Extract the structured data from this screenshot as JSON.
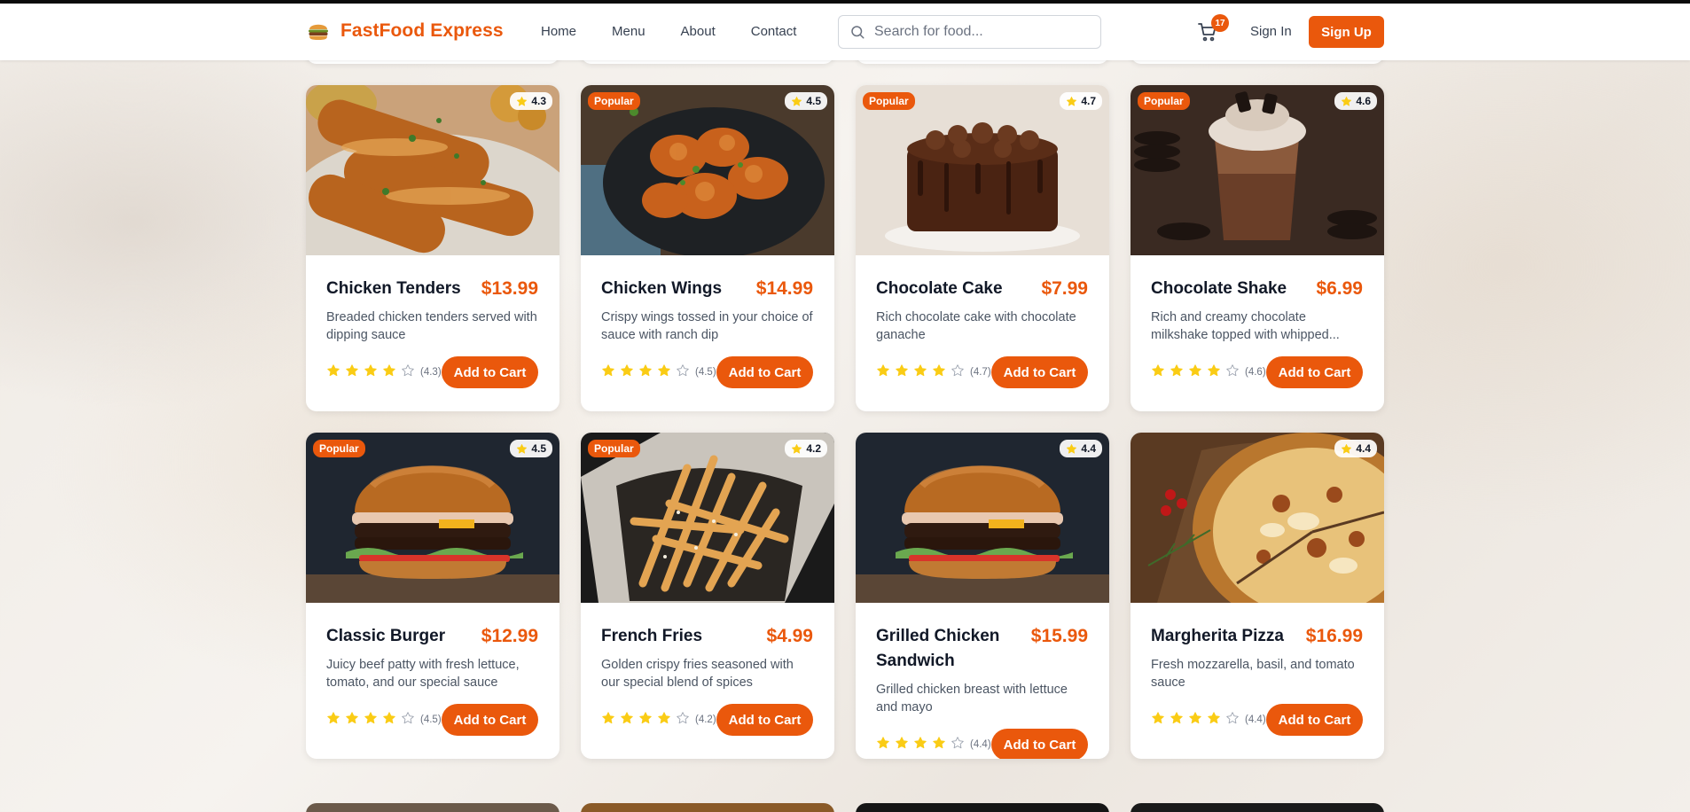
{
  "header": {
    "brand": "FastFood Express",
    "nav": [
      "Home",
      "Menu",
      "About",
      "Contact"
    ],
    "search_placeholder": "Search for food...",
    "cart_count": "17",
    "sign_in": "Sign In",
    "sign_up": "Sign Up"
  },
  "colors": {
    "accent": "#ea580c",
    "star": "#facc15"
  },
  "products": [
    {
      "name": "Chicken Tenders",
      "price": "$13.99",
      "description": "Breaded chicken tenders served with dipping sauce",
      "rating": "4.3",
      "rating_label": "(4.3)",
      "popular": false,
      "filled_stars": 4,
      "image_icon": "chicken-tenders-photo"
    },
    {
      "name": "Chicken Wings",
      "price": "$14.99",
      "description": "Crispy wings tossed in your choice of sauce with ranch dip",
      "rating": "4.5",
      "rating_label": "(4.5)",
      "popular": true,
      "filled_stars": 4,
      "image_icon": "chicken-wings-photo"
    },
    {
      "name": "Chocolate Cake",
      "price": "$7.99",
      "description": "Rich chocolate cake with chocolate ganache",
      "rating": "4.7",
      "rating_label": "(4.7)",
      "popular": true,
      "filled_stars": 4,
      "image_icon": "chocolate-cake-photo"
    },
    {
      "name": "Chocolate Shake",
      "price": "$6.99",
      "description": "Rich and creamy chocolate milkshake topped with whipped...",
      "rating": "4.6",
      "rating_label": "(4.6)",
      "popular": true,
      "filled_stars": 4,
      "image_icon": "chocolate-shake-photo"
    },
    {
      "name": "Classic Burger",
      "price": "$12.99",
      "description": "Juicy beef patty with fresh lettuce, tomato, and our special sauce",
      "rating": "4.5",
      "rating_label": "(4.5)",
      "popular": true,
      "filled_stars": 4,
      "image_icon": "burger-photo"
    },
    {
      "name": "French Fries",
      "price": "$4.99",
      "description": "Golden crispy fries seasoned with our special blend of spices",
      "rating": "4.2",
      "rating_label": "(4.2)",
      "popular": true,
      "filled_stars": 4,
      "image_icon": "fries-photo"
    },
    {
      "name": "Grilled Chicken Sandwich",
      "price": "$15.99",
      "description": "Grilled chicken breast with lettuce and mayo",
      "rating": "4.4",
      "rating_label": "(4.4)",
      "popular": false,
      "filled_stars": 4,
      "image_icon": "burger-photo"
    },
    {
      "name": "Margherita Pizza",
      "price": "$16.99",
      "description": "Fresh mozzarella, basil, and tomato sauce",
      "rating": "4.4",
      "rating_label": "(4.4)",
      "popular": false,
      "filled_stars": 4,
      "image_icon": "pizza-photo"
    }
  ],
  "popular_label": "Popular",
  "add_to_cart_label": "Add to Cart"
}
